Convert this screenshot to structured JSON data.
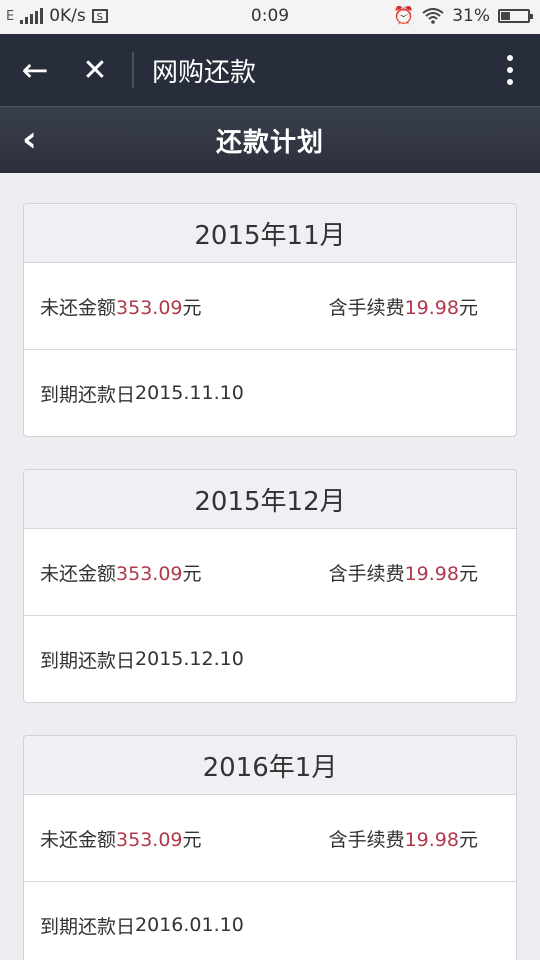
{
  "status_bar": {
    "network_type": "E",
    "speed": "0K/s",
    "sim_icon_text": "S",
    "time": "0:09",
    "battery": "31%",
    "battery_level": 0.31
  },
  "app_bar": {
    "back_glyph": "←",
    "close_glyph": "✕",
    "title": "网购还款"
  },
  "sub_header": {
    "back_glyph": "‹",
    "title": "还款计划"
  },
  "labels": {
    "unpaid": "未还金额",
    "fee": "含手续费",
    "currency": "元",
    "due": "到期还款日"
  },
  "plans": [
    {
      "month": "2015年11月",
      "amount": "353.09",
      "fee": "19.98",
      "due_date": "2015.11.10"
    },
    {
      "month": "2015年12月",
      "amount": "353.09",
      "fee": "19.98",
      "due_date": "2015.12.10"
    },
    {
      "month": "2016年1月",
      "amount": "353.09",
      "fee": "19.98",
      "due_date": "2016.01.10"
    }
  ],
  "colors": {
    "accent_red": "#b0384a",
    "app_bar_bg": "#272d3a"
  }
}
